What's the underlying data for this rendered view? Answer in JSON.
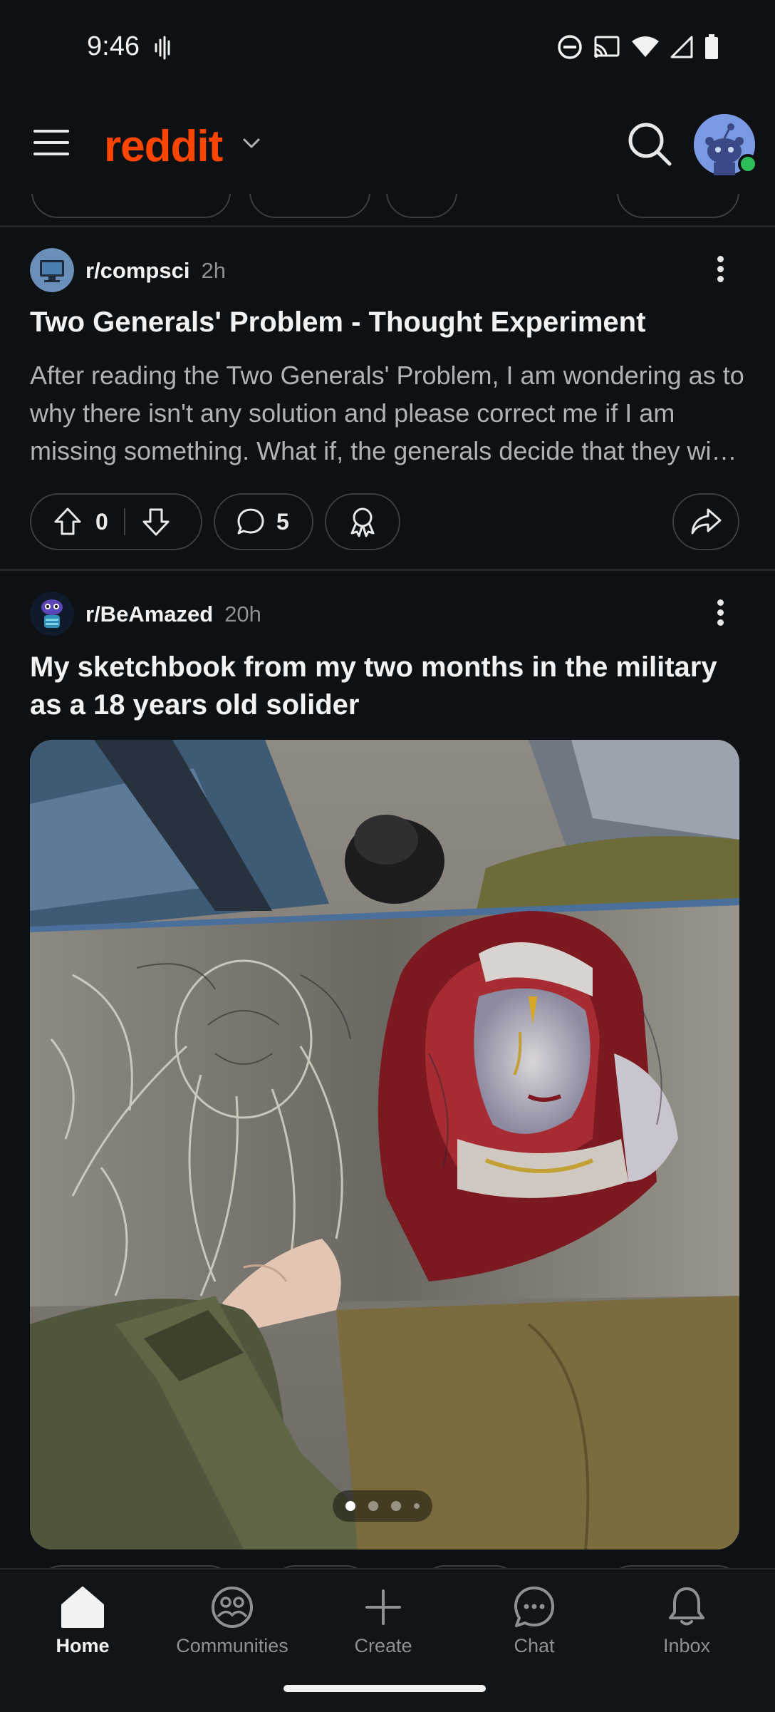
{
  "status_bar": {
    "time": "9:46"
  },
  "header": {
    "brand": "reddit"
  },
  "posts": [
    {
      "subreddit": "r/compsci",
      "age": "2h",
      "title": "Two Generals' Problem - Thought Experiment",
      "body": "After reading the Two Generals' Problem, I am wondering as to why there isn't any solution and please correct me if I am missing something. What if, the generals decide that they wi…",
      "score": "0",
      "comments": "5"
    },
    {
      "subreddit": "r/BeAmazed",
      "age": "20h",
      "title": "My sketchbook from my two months in the military as a 18 years old solider",
      "gallery": {
        "current_index": 1,
        "total": 4
      }
    }
  ],
  "bottom_nav": [
    {
      "label": "Home",
      "icon": "home-icon",
      "active": true
    },
    {
      "label": "Communities",
      "icon": "communities-icon",
      "active": false
    },
    {
      "label": "Create",
      "icon": "plus-icon",
      "active": false
    },
    {
      "label": "Chat",
      "icon": "chat-icon",
      "active": false
    },
    {
      "label": "Inbox",
      "icon": "bell-icon",
      "active": false
    }
  ],
  "colors": {
    "brand": "#ff4500",
    "background": "#0e1113",
    "online": "#2ebd59",
    "avatar": "#7a9be4"
  }
}
